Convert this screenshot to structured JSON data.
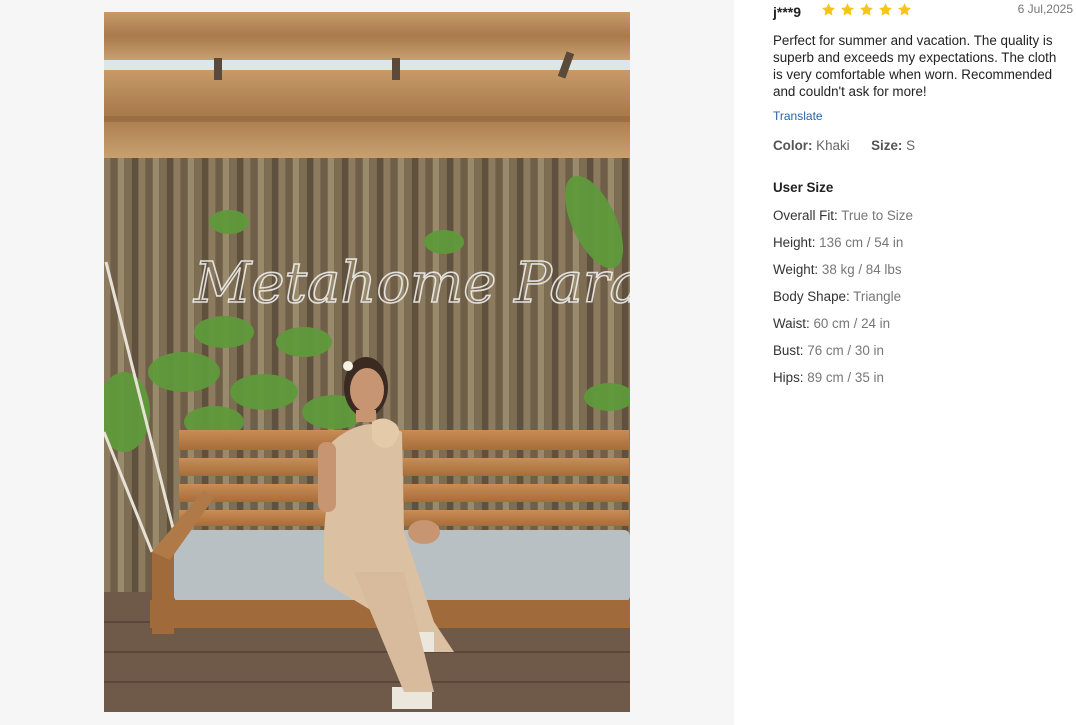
{
  "review": {
    "username": "j***9",
    "rating": 5,
    "star_color": "#f5c518",
    "date": "6 Jul,2025",
    "text": "Perfect for summer and vacation. The quality is superb and exceeds my expectations. The cloth is very comfortable when worn. Recommended and couldn't ask for more!",
    "translate_label": "Translate",
    "color_label": "Color:",
    "color_value": "Khaki",
    "size_label": "Size:",
    "size_value": "S"
  },
  "photo": {
    "sign_text": "Metahome Paradise",
    "icon": "review-photo"
  },
  "user_size": {
    "title": "User Size",
    "rows": [
      {
        "key": "Overall Fit:",
        "value": "True to Size"
      },
      {
        "key": "Height:",
        "value": "136 cm / 54 in"
      },
      {
        "key": "Weight:",
        "value": "38 kg / 84 lbs"
      },
      {
        "key": "Body Shape:",
        "value": "Triangle"
      },
      {
        "key": "Waist:",
        "value": "60 cm / 24 in"
      },
      {
        "key": "Bust:",
        "value": "76 cm / 30 in"
      },
      {
        "key": "Hips:",
        "value": "89 cm / 35 in"
      }
    ]
  }
}
